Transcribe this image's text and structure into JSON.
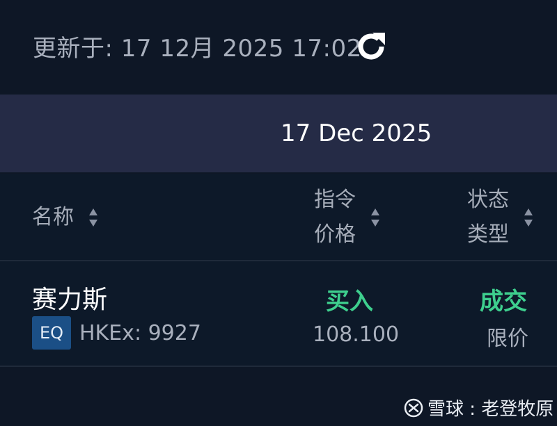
{
  "header": {
    "updated_text": "更新于: 17 12月 2025 17:02",
    "refresh_icon": "refresh-icon"
  },
  "date_band": {
    "date": "17 Dec 2025"
  },
  "columns": {
    "name": "名称",
    "price_line1": "指令",
    "price_line2": "价格",
    "status_line1": "状态",
    "status_line2": "类型",
    "sort_icon": "sort-arrows-icon"
  },
  "order": {
    "name": "赛力斯",
    "badge": "EQ",
    "exchange": "HKEx: 9927",
    "side": "买入",
    "price": "108.100",
    "status": "成交",
    "order_type": "限价"
  },
  "watermark": {
    "text": "雪球 : 老登牧原"
  },
  "colors": {
    "background": "#0e1726",
    "band": "#252b46",
    "accent_green": "#3ecf8e",
    "badge_blue": "#1b4f86"
  }
}
